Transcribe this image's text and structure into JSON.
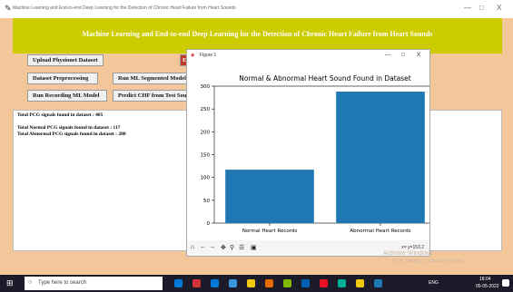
{
  "window": {
    "title": "Machine Learning and End-to-end Deep Learning for the Detection of Chronic Heart Failure from Heart Sounds",
    "controls": [
      "—",
      "□",
      "X"
    ]
  },
  "header": {
    "text": "Machine Learning and End-to-end Deep Learning for the Detection of Chronic Heart Failure from Heart Sounds"
  },
  "buttons": {
    "upload": "Upload Physionet Dataset",
    "preprocess": "Dataset Preprocessing",
    "segmented": "Run ML Segmented Model",
    "recording": "Run Recording ML Model",
    "predict": "Predict CHF from Test Sound",
    "hidden_partial": "E"
  },
  "output": {
    "lines": [
      "Total PCG signals found in dataset : 405",
      "Total Normal PCG signals found in dataset : 117",
      "Total Abnormal PCG signals found in dataset : 288"
    ]
  },
  "figure": {
    "window_title": "Figure 1",
    "controls": [
      "—",
      "□",
      "X"
    ],
    "toolbar": [
      "home",
      "back",
      "forward",
      "pan",
      "zoom",
      "configure",
      "save"
    ],
    "cursor_readout": "x= y=153.2"
  },
  "chart_data": {
    "type": "bar",
    "title": "Normal & Abnormal Heart Sound Found in Dataset",
    "categories": [
      "Normal Heart Records",
      "Abnormal Heart Records"
    ],
    "values": [
      117,
      288
    ],
    "ylim": [
      0,
      300
    ],
    "yticks": [
      0,
      50,
      100,
      150,
      200,
      250,
      300
    ],
    "bar_color": "#1f77b4",
    "grid": false
  },
  "watermark": {
    "line1": "Activate Windows",
    "line2": "Go to Settings to activate Windows."
  },
  "taskbar": {
    "search_placeholder": "Type here to search",
    "time": "18:04",
    "date": "05-05-2022",
    "tray_text": "ENG"
  }
}
